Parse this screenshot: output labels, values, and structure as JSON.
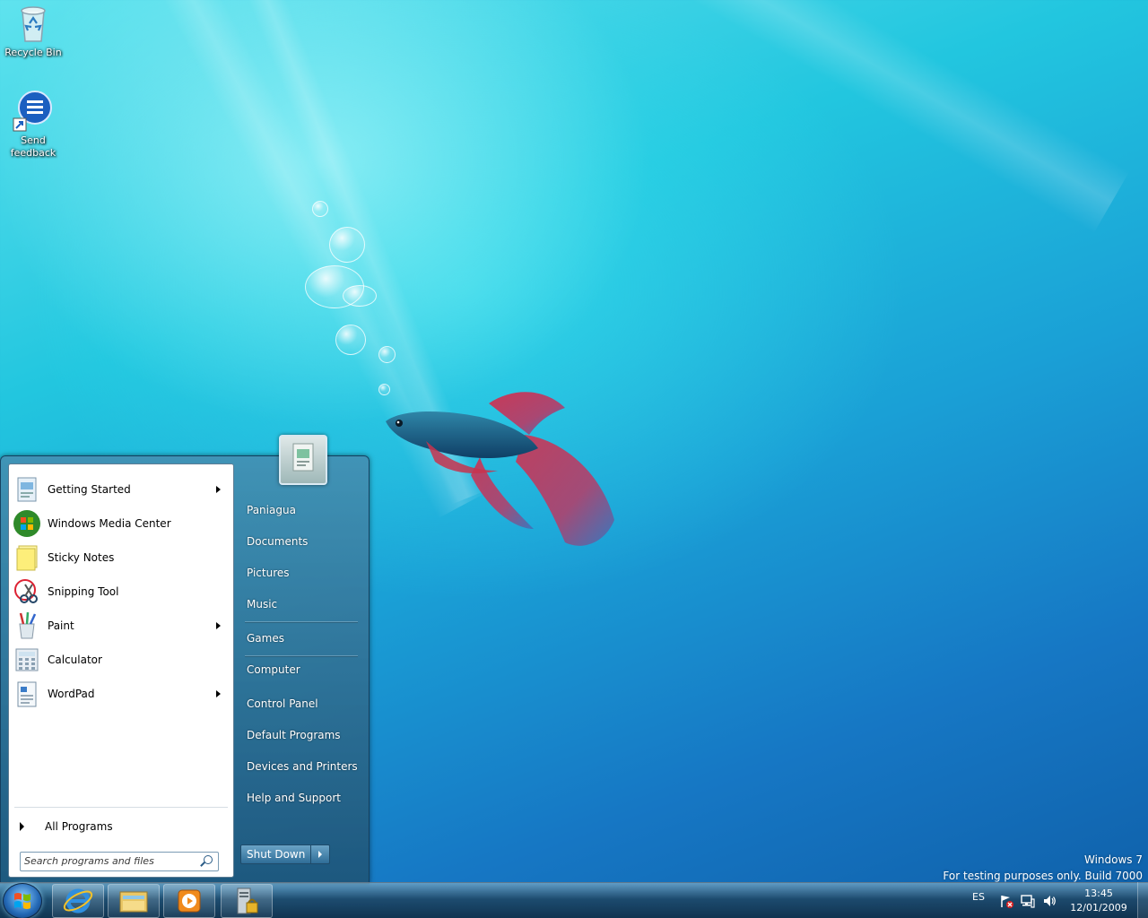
{
  "desktop": {
    "icons": [
      {
        "label": "Recycle Bin",
        "icon": "recycle-bin-icon"
      },
      {
        "label_line1": "Send",
        "label_line2": "feedback",
        "icon": "send-feedback-icon"
      }
    ],
    "watermark": {
      "line1": "Windows 7",
      "line2": "For testing purposes only. Build 7000"
    }
  },
  "start_menu": {
    "programs": [
      {
        "label": "Getting Started",
        "icon": "getting-started-icon",
        "has_submenu": true
      },
      {
        "label": "Windows Media Center",
        "icon": "media-center-icon",
        "has_submenu": false
      },
      {
        "label": "Sticky Notes",
        "icon": "sticky-notes-icon",
        "has_submenu": false
      },
      {
        "label": "Snipping Tool",
        "icon": "snipping-tool-icon",
        "has_submenu": false
      },
      {
        "label": "Paint",
        "icon": "paint-icon",
        "has_submenu": true
      },
      {
        "label": "Calculator",
        "icon": "calculator-icon",
        "has_submenu": false
      },
      {
        "label": "WordPad",
        "icon": "wordpad-icon",
        "has_submenu": true
      }
    ],
    "all_programs": "All Programs",
    "search_placeholder": "Search programs and files",
    "right_items": [
      "Paniagua",
      "Documents",
      "Pictures",
      "Music",
      "Games",
      "Computer",
      "Control Panel",
      "Default Programs",
      "Devices and Printers",
      "Help and Support"
    ],
    "shutdown_label": "Shut Down"
  },
  "taskbar": {
    "pinned": [
      "internet-explorer-icon",
      "windows-explorer-icon",
      "media-player-icon",
      "server-lock-icon"
    ],
    "language": "ES",
    "time": "13:45",
    "date": "12/01/2009"
  },
  "colors": {
    "desktop_light": "#5fe3ee",
    "desktop_dark": "#0f5fa8",
    "menu_pane": "#ffffff"
  }
}
